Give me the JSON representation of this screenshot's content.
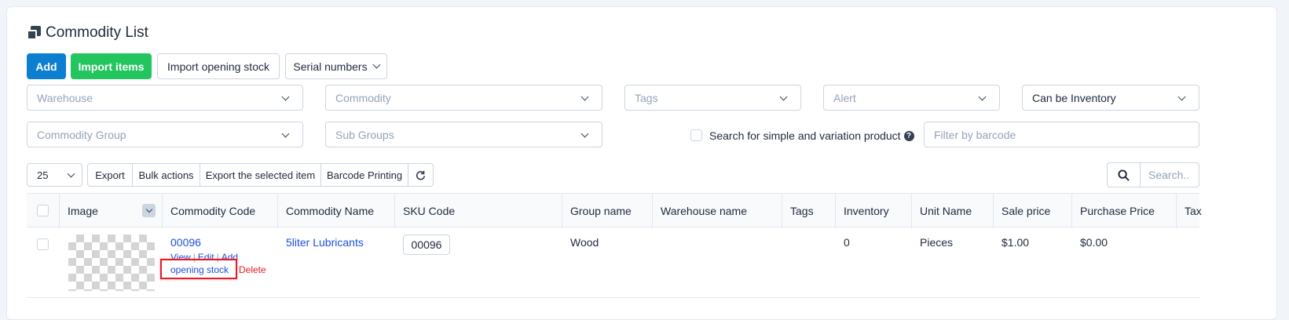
{
  "page": {
    "title": "Commodity List"
  },
  "toolbar": {
    "add": "Add",
    "import_items": "Import items",
    "import_opening_stock": "Import opening stock",
    "serial_numbers": "Serial numbers"
  },
  "filters": {
    "warehouse": "Warehouse",
    "commodity": "Commodity",
    "tags": "Tags",
    "alert": "Alert",
    "inventory_mode": "Can be Inventory",
    "commodity_group": "Commodity Group",
    "sub_groups": "Sub Groups",
    "simple_variation_label": "Search for simple and variation product",
    "barcode_placeholder": "Filter by barcode"
  },
  "table_controls": {
    "page_length": "25",
    "export": "Export",
    "bulk_actions": "Bulk actions",
    "export_selected": "Export the selected item",
    "barcode_printing": "Barcode Printing",
    "search_placeholder": "Search.."
  },
  "columns": [
    "Image",
    "Commodity Code",
    "Commodity Name",
    "SKU Code",
    "Group name",
    "Warehouse name",
    "Tags",
    "Inventory",
    "Unit Name",
    "Sale price",
    "Purchase Price",
    "Tax"
  ],
  "rows": [
    {
      "code": "00096",
      "actions": {
        "view": "View",
        "edit": "Edit",
        "add": "Add",
        "opening_stock": "opening stock",
        "delete": "Delete"
      },
      "name": "5liter Lubricants",
      "sku": "00096",
      "group": "Wood",
      "warehouse": "",
      "tags": "",
      "inventory": "0",
      "unit": "Pieces",
      "sale_price": "$1.00",
      "purchase_price": "$0.00"
    }
  ],
  "colors": {
    "primary": "#0d7fd0",
    "success": "#22c55e",
    "danger": "#e11d28",
    "link": "#1d4ed8"
  },
  "icons": [
    "copy-icon",
    "chevron-down-icon",
    "help-icon",
    "refresh-icon",
    "search-icon",
    "checkbox-icon",
    "image-placeholder-icon"
  ]
}
